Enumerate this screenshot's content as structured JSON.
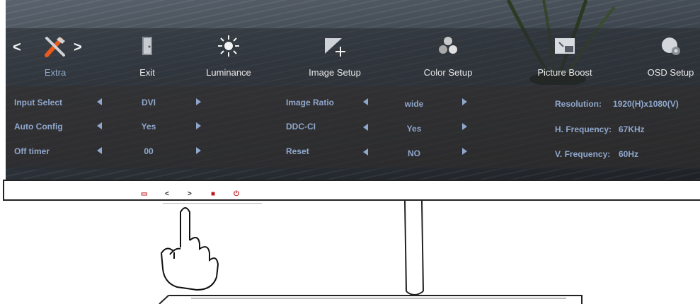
{
  "menu": {
    "left_arrow": "<",
    "right_arrow": ">",
    "items": [
      {
        "label": "Extra",
        "icon": "tools-icon",
        "active": true
      },
      {
        "label": "Exit",
        "icon": "exit-door-icon"
      },
      {
        "label": "Luminance",
        "icon": "sun-icon"
      },
      {
        "label": "Image Setup",
        "icon": "image-setup-icon"
      },
      {
        "label": "Color Setup",
        "icon": "color-setup-icon"
      },
      {
        "label": "Picture Boost",
        "icon": "picture-boost-icon"
      },
      {
        "label": "OSD Setup",
        "icon": "osd-setup-icon"
      }
    ]
  },
  "settings_left": [
    {
      "label": "Input Select",
      "value": "DVI"
    },
    {
      "label": "Auto Config",
      "value": "Yes"
    },
    {
      "label": "Off timer",
      "value": "00"
    }
  ],
  "settings_mid": [
    {
      "label": "Image Ratio",
      "value": "wide"
    },
    {
      "label": "DDC-CI",
      "value": "Yes"
    },
    {
      "label": "Reset",
      "value": "NO"
    }
  ],
  "info": [
    {
      "label": "Resolution:",
      "value": "1920(H)x1080(V)"
    },
    {
      "label": "H. Frequency:",
      "value": "67KHz"
    },
    {
      "label": "V. Frequency:",
      "value": "60Hz"
    }
  ],
  "buttons": [
    {
      "glyph": "▭",
      "name": "source-button-icon"
    },
    {
      "glyph": "<",
      "name": "left-button-icon"
    },
    {
      "glyph": ">",
      "name": "right-button-icon"
    },
    {
      "glyph": "■",
      "name": "menu-button-icon"
    },
    {
      "glyph": "⏻",
      "name": "power-button-icon"
    }
  ],
  "colors": {
    "osd_text": "#8fa7cc",
    "button_red": "#c31616"
  }
}
